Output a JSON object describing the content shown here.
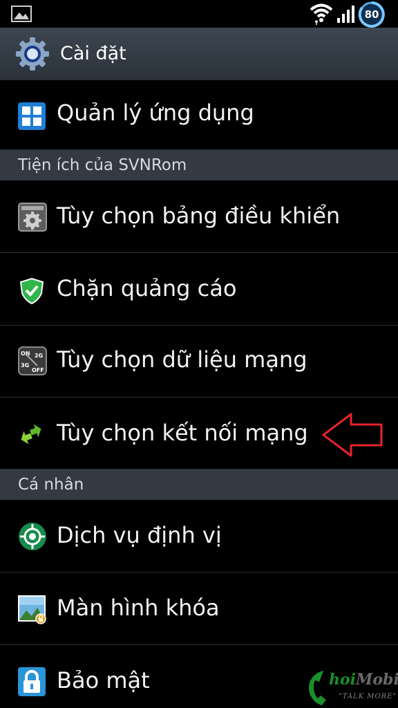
{
  "status_bar": {
    "battery_level": "80",
    "icons": [
      "gallery-icon",
      "wifi-icon",
      "signal-icon",
      "battery-icon"
    ]
  },
  "action_bar": {
    "title": "Cài đặt",
    "icon": "settings-gear-icon"
  },
  "rows": {
    "app_manager": {
      "label": "Quản lý ứng dụng",
      "icon": "app-grid-icon"
    },
    "panel_options": {
      "label": "Tùy chọn bảng điều khiển",
      "icon": "control-panel-gear-icon"
    },
    "ad_block": {
      "label": "Chặn quảng cáo",
      "icon": "shield-check-icon"
    },
    "data_options": {
      "label": "Tùy chọn dữ liệu mạng",
      "icon": "network-data-toggle-icon"
    },
    "network_options": {
      "label": "Tùy chọn kết nối mạng",
      "icon": "transfer-arrows-icon"
    },
    "location": {
      "label": "Dịch vụ định vị",
      "icon": "location-target-icon"
    },
    "lock_screen": {
      "label": "Màn hình khóa",
      "icon": "lock-screen-icon"
    },
    "security": {
      "label": "Bảo mật",
      "icon": "padlock-icon"
    }
  },
  "sections": {
    "svnrom": "Tiện ích của SVNRom",
    "personal": "Cá nhân"
  },
  "data_icon_labels": {
    "on": "ON",
    "g2": "2G",
    "g3": "3G",
    "off": "OFF"
  },
  "watermark": {
    "brand_part1": "hoi",
    "brand_part2": "Mobile",
    "slogan": "\"TALK MORE\""
  },
  "colors": {
    "background": "#000000",
    "action_bar": "#3a434e",
    "section_header": "#333a42",
    "annotation_arrow": "#e8232a",
    "shield_green": "#2fb54a",
    "watermark_green": "#1a8f2a"
  }
}
